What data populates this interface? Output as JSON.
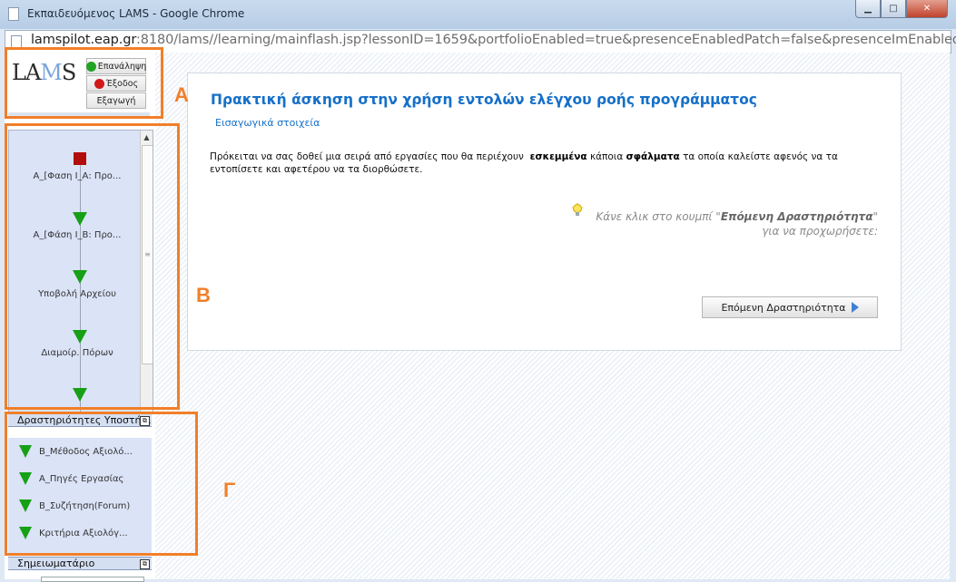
{
  "window": {
    "title": "Εκπαιδευόμενος LAMS - Google Chrome",
    "controls": {
      "minimize": "▁",
      "maximize": "□",
      "close": "✕"
    }
  },
  "address": {
    "host": "lamspilot.eap.gr",
    "rest": ":8180/lams//learning/mainflash.jsp?lessonID=1659&portfolioEnabled=true&presenceEnabledPatch=false&presenceImEnabled"
  },
  "sidebar": {
    "logo": {
      "part1": "LA",
      "part2": "M",
      "part3": "S"
    },
    "buttons": {
      "restart": "Επανάληψη",
      "exit": "Έξοδος",
      "export": "Εξαγωγή"
    },
    "sequence": [
      "Α_[Φαση Ι_Α: Προ...",
      "Α_[Φάση Ι_Β: Προ...",
      "Υποβολή Αρχείου",
      "Διαμοίρ. Πόρων"
    ],
    "support_title": "Δραστηριότητες Υποστήριξης",
    "support_items": [
      "Β_Μέθοδος Αξιολό...",
      "Α_Πηγές Εργασίας",
      "Β_Συζήτηση(Forum)",
      "Κριτήρια Αξιολόγ..."
    ],
    "notebook_title": "Σημειωματάριο"
  },
  "main": {
    "title": "Πρακτική άσκηση στην χρήση εντολών ελέγχου ροής προγράμματος",
    "subtitle": "Εισαγωγικά στοιχεία",
    "para_a": "Πρόκειται να σας δοθεί μια σειρά από εργασίες που θα περιέχουν",
    "para_b1": "εσκεμμένα",
    "para_c": "κάποια",
    "para_b2": "σφάλματα",
    "para_d": "τα οποία καλείστε αφενός να τα εντοπίσετε και αφετέρου να τα διορθώσετε.",
    "hint_pre": "Κάνε κλικ στο κουμπί \"",
    "hint_bold": "Επόμενη Δραστηριότητα",
    "hint_post": "\"",
    "hint_line2": "για να προχωρήσετε:",
    "next_button": "Επόμενη Δραστηριότητα"
  },
  "annotations": {
    "a": "Α",
    "b": "Β",
    "c": "Γ"
  },
  "colors": {
    "annotation": "#f17f29",
    "link_blue": "#1670c8",
    "current_square": "#b20c0c",
    "arrow_green": "#16a016"
  }
}
